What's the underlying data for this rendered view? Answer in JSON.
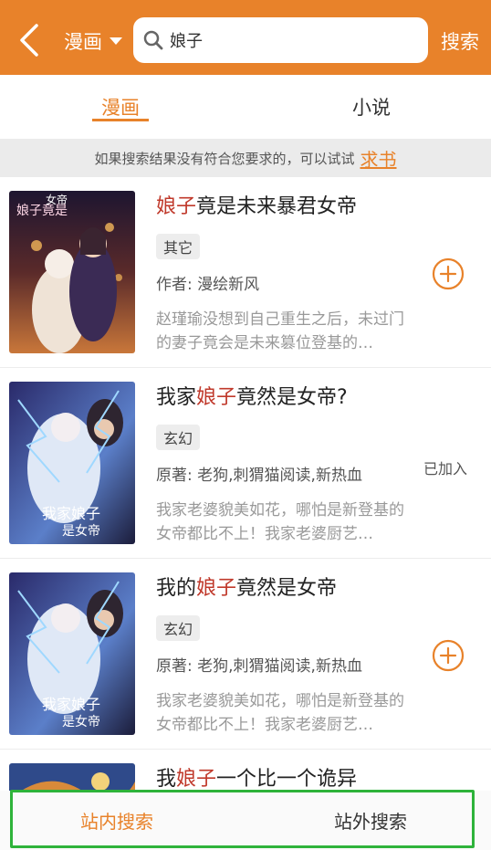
{
  "header": {
    "category_label": "漫画",
    "search_value": "娘子",
    "search_button_label": "搜索"
  },
  "tabs": [
    {
      "label": "漫画",
      "active": true
    },
    {
      "label": "小说",
      "active": false
    }
  ],
  "hint": {
    "text": "如果搜索结果没有符合您要求的，可以试试",
    "link_label": "求书"
  },
  "results": [
    {
      "title_highlight": "娘子",
      "title_pre": "",
      "title_post": "竟是未来暴君女帝",
      "tag": "其它",
      "author": "作者: 漫绘新风",
      "description": "赵瑾瑜没想到自己重生之后，未过门的妻子竟会是未来篡位登基的…",
      "action_icon": "plus-circle-icon"
    },
    {
      "title_pre": "我家",
      "title_highlight": "娘子",
      "title_post": "竟然是女帝?",
      "tag": "玄幻",
      "author": "原著: 老狗,刺猬猫阅读,新热血",
      "description": "我家老婆貌美如花，哪怕是新登基的女帝都比不上！我家老婆厨艺…",
      "action_label": "已加入"
    },
    {
      "title_pre": "我的",
      "title_highlight": "娘子",
      "title_post": "竟然是女帝",
      "tag": "玄幻",
      "author": "原著: 老狗,刺猬猫阅读,新热血",
      "description": "我家老婆貌美如花，哪怕是新登基的女帝都比不上！我家老婆厨艺…",
      "action_icon": "plus-circle-icon"
    },
    {
      "title_pre": "我",
      "title_highlight": "娘子",
      "title_post": "一个比一个诡异"
    }
  ],
  "bottom_tabs": [
    {
      "label": "站内搜索",
      "active": true
    },
    {
      "label": "站外搜索",
      "active": false
    }
  ],
  "colors": {
    "accent": "#e8822a",
    "highlight": "#c0392b",
    "selection_outline": "#2eb33a"
  },
  "cover_art_alt": [
    "娘子竟是未来暴君女帝",
    "我家娘子竟然是女帝",
    "我家娘子竟然是女帝"
  ]
}
